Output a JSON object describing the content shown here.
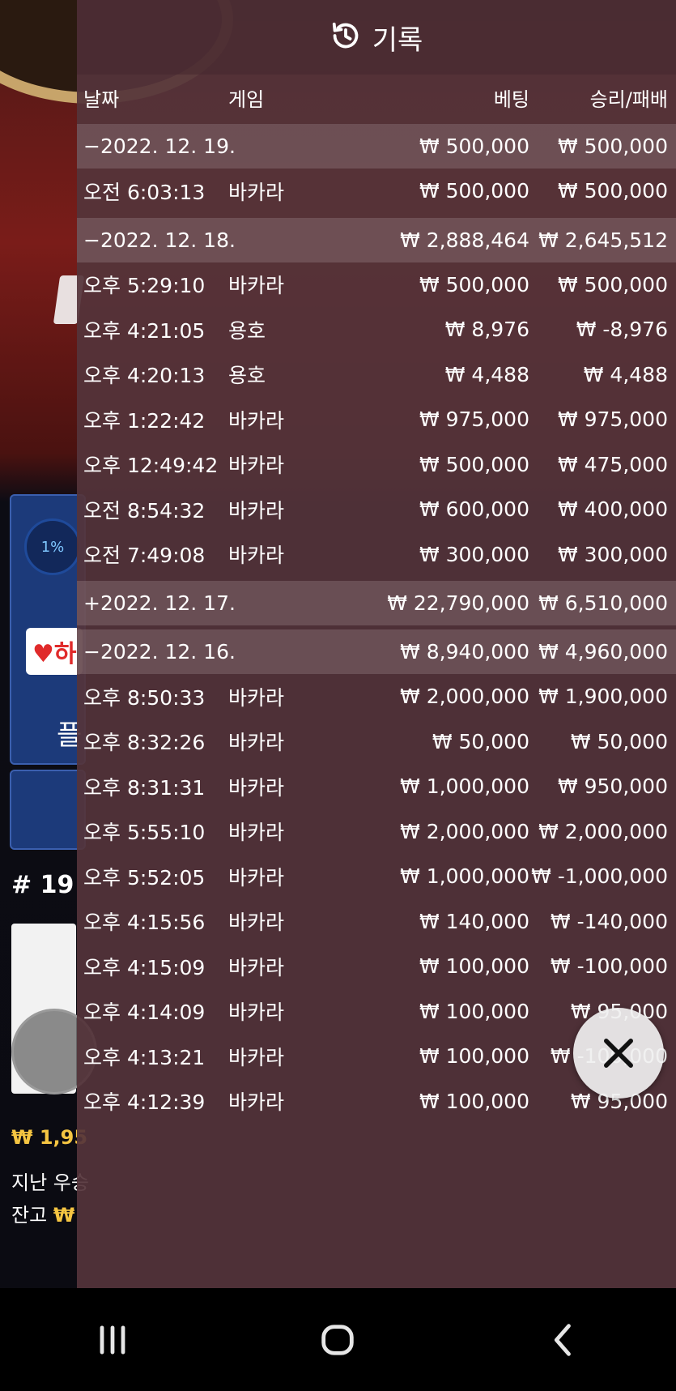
{
  "background": {
    "percent": "1%",
    "badge": "♥하",
    "button_label": "플",
    "round": "# 19",
    "balance": "₩ 1,95",
    "last_win": "지난 우승",
    "remain_label": "잔고",
    "remain_currency": "₩"
  },
  "history": {
    "title": "기록",
    "columns": {
      "date": "날짜",
      "game": "게임",
      "bet": "베팅",
      "win": "승리/패배"
    },
    "groups": [
      {
        "date": "−2022. 12. 19.",
        "bet": "₩ 500,000",
        "win": "₩ 500,000",
        "rows": [
          {
            "time": "오전 6:03:13",
            "game": "바카라",
            "bet": "₩ 500,000",
            "win": "₩ 500,000"
          }
        ]
      },
      {
        "date": "−2022. 12. 18.",
        "bet": "₩ 2,888,464",
        "win": "₩ 2,645,512",
        "rows": [
          {
            "time": "오후 5:29:10",
            "game": "바카라",
            "bet": "₩ 500,000",
            "win": "₩ 500,000"
          },
          {
            "time": "오후 4:21:05",
            "game": "용호",
            "bet": "₩ 8,976",
            "win": "₩ -8,976"
          },
          {
            "time": "오후 4:20:13",
            "game": "용호",
            "bet": "₩ 4,488",
            "win": "₩ 4,488"
          },
          {
            "time": "오후 1:22:42",
            "game": "바카라",
            "bet": "₩ 975,000",
            "win": "₩ 975,000"
          },
          {
            "time": "오후 12:49:42",
            "game": "바카라",
            "bet": "₩ 500,000",
            "win": "₩ 475,000"
          },
          {
            "time": "오전 8:54:32",
            "game": "바카라",
            "bet": "₩ 600,000",
            "win": "₩ 400,000"
          },
          {
            "time": "오전 7:49:08",
            "game": "바카라",
            "bet": "₩ 300,000",
            "win": "₩ 300,000"
          }
        ]
      },
      {
        "date": "+2022. 12. 17.",
        "bet": "₩ 22,790,000",
        "win": "₩ 6,510,000",
        "rows": []
      },
      {
        "date": "−2022. 12. 16.",
        "bet": "₩ 8,940,000",
        "win": "₩ 4,960,000",
        "rows": [
          {
            "time": "오후 8:50:33",
            "game": "바카라",
            "bet": "₩ 2,000,000",
            "win": "₩ 1,900,000"
          },
          {
            "time": "오후 8:32:26",
            "game": "바카라",
            "bet": "₩ 50,000",
            "win": "₩ 50,000"
          },
          {
            "time": "오후 8:31:31",
            "game": "바카라",
            "bet": "₩ 1,000,000",
            "win": "₩ 950,000"
          },
          {
            "time": "오후 5:55:10",
            "game": "바카라",
            "bet": "₩ 2,000,000",
            "win": "₩ 2,000,000"
          },
          {
            "time": "오후 5:52:05",
            "game": "바카라",
            "bet": "₩ 1,000,000",
            "win": "₩ -1,000,000"
          },
          {
            "time": "오후 4:15:56",
            "game": "바카라",
            "bet": "₩ 140,000",
            "win": "₩ -140,000"
          },
          {
            "time": "오후 4:15:09",
            "game": "바카라",
            "bet": "₩ 100,000",
            "win": "₩ -100,000"
          },
          {
            "time": "오후 4:14:09",
            "game": "바카라",
            "bet": "₩ 100,000",
            "win": "₩ 95,000"
          },
          {
            "time": "오후 4:13:21",
            "game": "바카라",
            "bet": "₩ 100,000",
            "win": "₩ -100,000"
          },
          {
            "time": "오후 4:12:39",
            "game": "바카라",
            "bet": "₩ 100,000",
            "win": "₩ 95,000"
          }
        ]
      }
    ]
  },
  "icons": {
    "title_icon": "history-icon",
    "close": "close-icon",
    "nav": [
      "recent-apps-icon",
      "home-icon",
      "back-icon"
    ]
  }
}
